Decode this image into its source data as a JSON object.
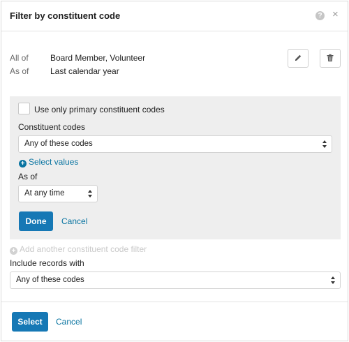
{
  "dialog": {
    "title": "Filter by constituent code",
    "help_glyph": "?",
    "close_glyph": "×"
  },
  "summary": {
    "rows": [
      {
        "label": "All of",
        "value": "Board Member, Volunteer"
      },
      {
        "label": "As of",
        "value": "Last calendar year"
      }
    ],
    "edit_icon": "pencil-icon",
    "delete_icon": "trash-icon"
  },
  "editor": {
    "primary_checkbox_label": "Use only primary constituent codes",
    "primary_checked": false,
    "codes_label": "Constituent codes",
    "codes_select_value": "Any of these codes",
    "select_values_link": "Select values",
    "as_of_label": "As of",
    "as_of_select_value": "At any time",
    "done_label": "Done",
    "cancel_label": "Cancel"
  },
  "add_filter_link": "Add another constituent code filter",
  "include": {
    "label": "Include records with",
    "select_value": "Any of these codes"
  },
  "footer": {
    "select_label": "Select",
    "cancel_label": "Cancel"
  },
  "colors": {
    "primary_button": "#1678b5",
    "link": "#0974a1",
    "panel_background": "#eeeeee"
  }
}
